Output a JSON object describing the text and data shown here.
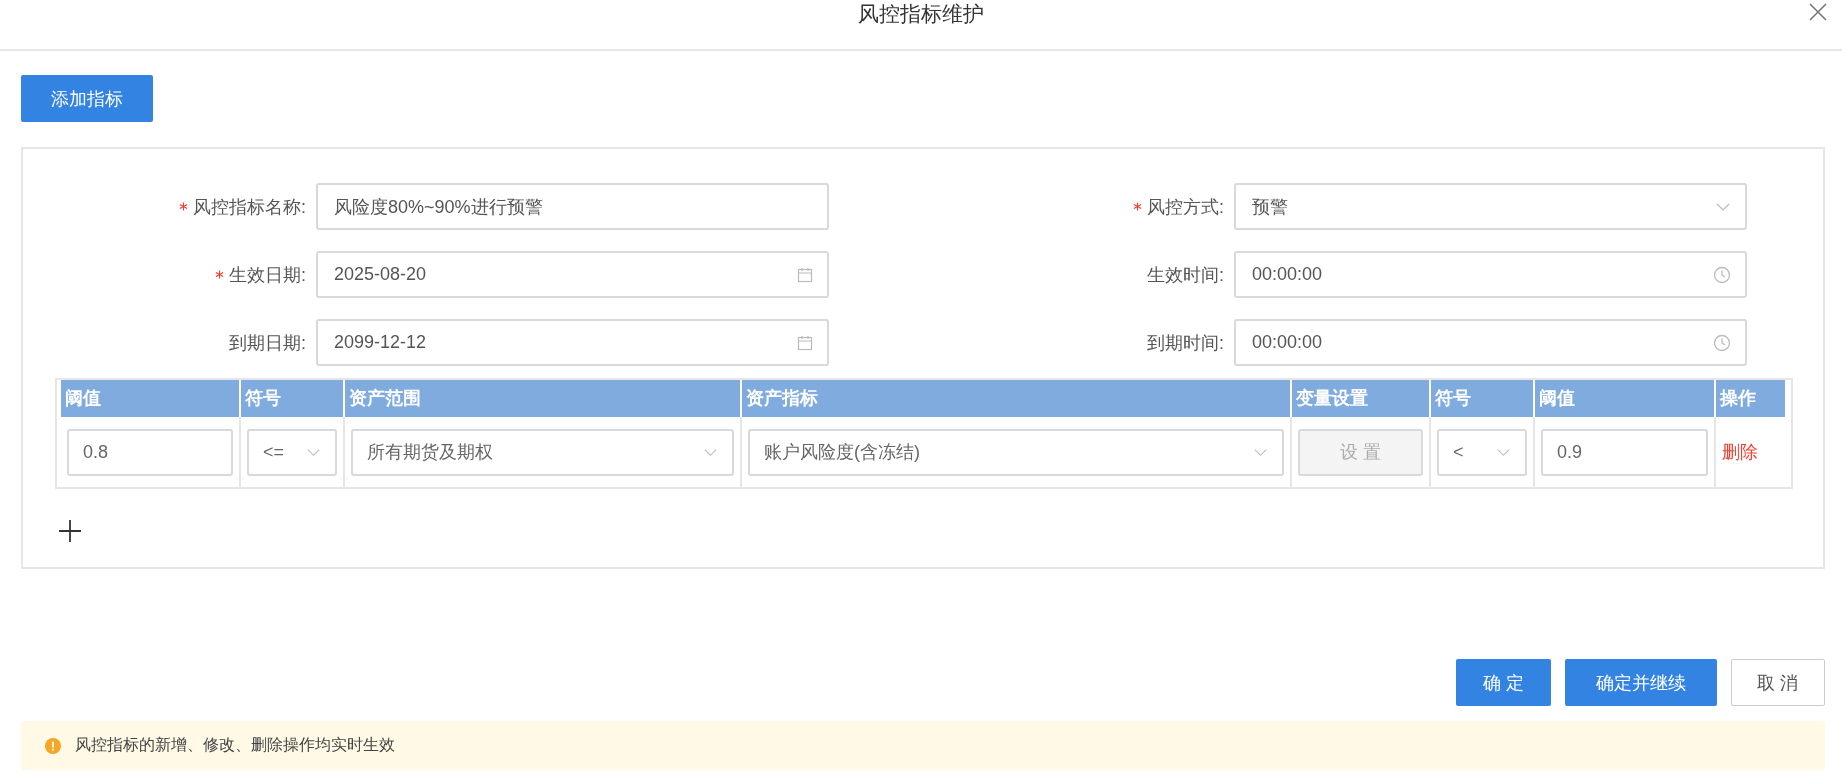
{
  "dialog": {
    "title": "风控指标维护"
  },
  "add_button": "添加指标",
  "form": {
    "fields": [
      {
        "label": "风控指标名称:",
        "required": true,
        "kind": "text",
        "value": "风险度80%~90%进行预警"
      },
      {
        "label": "风控方式:",
        "required": true,
        "kind": "select",
        "value": "预警"
      },
      {
        "label": "生效日期:",
        "required": true,
        "kind": "date",
        "value": "2025-08-20"
      },
      {
        "label": "生效时间:",
        "required": false,
        "kind": "time",
        "value": "00:00:00"
      },
      {
        "label": "到期日期:",
        "required": false,
        "kind": "date",
        "value": "2099-12-12"
      },
      {
        "label": "到期时间:",
        "required": false,
        "kind": "time",
        "value": "00:00:00"
      }
    ]
  },
  "table": {
    "columns": [
      "阈值",
      "符号",
      "资产范围",
      "资产指标",
      "变量设置",
      "符号",
      "阈值",
      "操作"
    ],
    "rows": [
      {
        "cells": [
          {
            "kind": "input",
            "value": "0.8"
          },
          {
            "kind": "select",
            "value": "<="
          },
          {
            "kind": "select",
            "value": "所有期货及期权"
          },
          {
            "kind": "select",
            "value": "账户风险度(含冻结)"
          },
          {
            "kind": "button",
            "value": "设 置",
            "disabled": true
          },
          {
            "kind": "select",
            "value": "<"
          },
          {
            "kind": "input",
            "value": "0.9"
          },
          {
            "kind": "link",
            "value": "删除"
          }
        ]
      }
    ]
  },
  "footer_buttons": [
    {
      "label": "确 定",
      "primary": true
    },
    {
      "label": "确定并继续",
      "primary": true
    },
    {
      "label": "取 消",
      "primary": false
    }
  ],
  "notice": "风控指标的新增、修改、删除操作均实时生效"
}
